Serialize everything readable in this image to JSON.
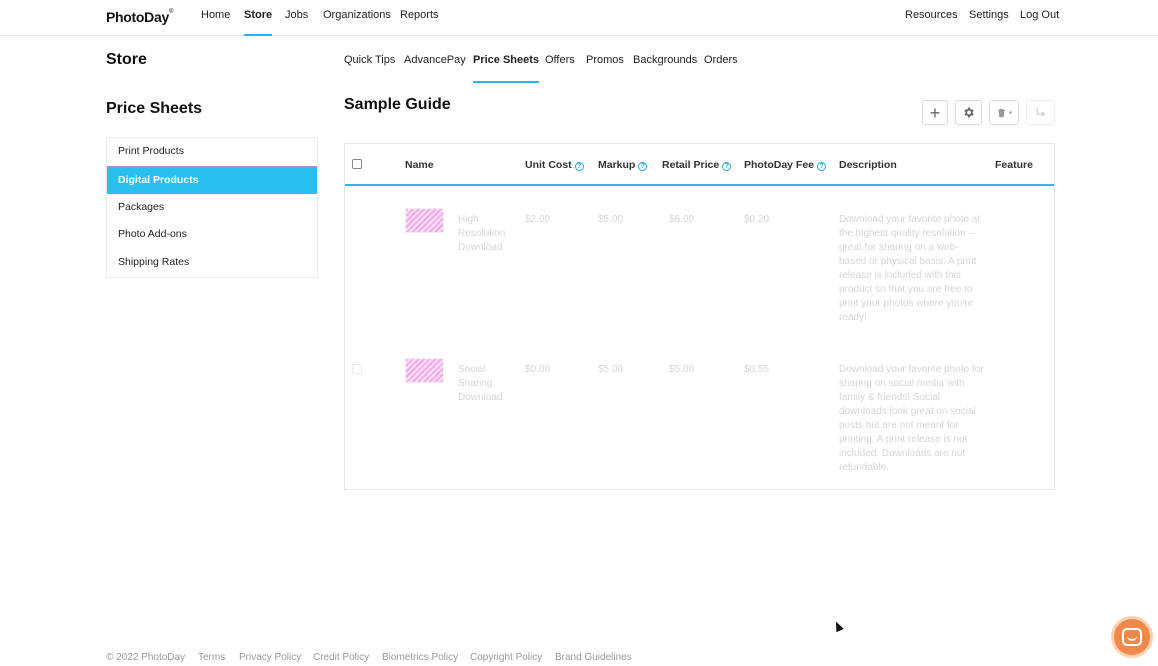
{
  "brand": {
    "name": "PhotoDay",
    "mark": "®"
  },
  "topnav": {
    "left": [
      "Home",
      "Store",
      "Jobs",
      "Organizations",
      "Reports"
    ],
    "active": "Store",
    "right": [
      "Resources",
      "Settings",
      "Log Out"
    ]
  },
  "store": {
    "title": "Store",
    "tabs": [
      "Quick Tips",
      "AdvancePay",
      "Price Sheets",
      "Offers",
      "Promos",
      "Backgrounds",
      "Orders"
    ],
    "active_tab": "Price Sheets"
  },
  "sidebar": {
    "title": "Price Sheets",
    "items": [
      "Print Products",
      "Digital Products",
      "Packages",
      "Photo Add-ons",
      "Shipping Rates"
    ],
    "active": "Digital Products"
  },
  "main": {
    "title": "Sample Guide",
    "toolbar": {
      "add": "+",
      "settings": "settings",
      "delete": "delete",
      "export": "export"
    },
    "table": {
      "headers": [
        "Name",
        "Unit Cost",
        "Markup",
        "Retail Price",
        "PhotoDay Fee",
        "Description",
        "Feature"
      ],
      "rows": [
        {
          "name": "High Resolution Download",
          "unit_cost": "$2.00",
          "markup": "$5.00",
          "retail_price": "$6.00",
          "fee": "$0.20",
          "description": "Download your favorite photo at the highest quality resolution – great for sharing on a web-based or physical basis. A print release is included with this product so that you are free to print your photos where you're ready!"
        },
        {
          "name": "Social Sharing Download",
          "unit_cost": "$0.00",
          "markup": "$5.00",
          "retail_price": "$5.00",
          "fee": "$0.55",
          "description": "Download your favorite photo for sharing on social media with family & friends! Social downloads look great on social posts but are not meant for printing. A print release is not included. Downloads are not refundable."
        }
      ]
    }
  },
  "footer": {
    "copyright": "© 2022 PhotoDay",
    "links": [
      "Terms",
      "Privacy Policy",
      "Credit Policy",
      "Biometrics Policy",
      "Copyright Policy",
      "Brand Guidelines"
    ]
  },
  "colors": {
    "accent": "#29b6e8",
    "active_bg": "#29c0f0",
    "chat": "#f08a4b"
  }
}
